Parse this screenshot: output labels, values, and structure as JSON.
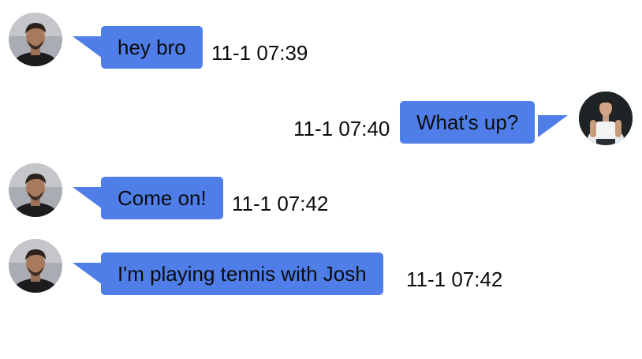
{
  "messages": [
    {
      "side": "incoming",
      "avatar_icon": "man-avatar-icon",
      "text": "hey bro",
      "time": "11-1 07:39"
    },
    {
      "side": "outgoing",
      "avatar_icon": "man-avatar-icon",
      "text": "What's up?",
      "time": "11-1 07:40"
    },
    {
      "side": "incoming",
      "avatar_icon": "man-avatar-icon",
      "text": "Come on!",
      "time": "11-1 07:42"
    },
    {
      "side": "incoming",
      "avatar_icon": "man-avatar-icon",
      "text": "I'm playing tennis with Josh",
      "time": "11-1 07:42"
    }
  ],
  "colors": {
    "bubble": "#4f7ee8",
    "text": "#0b0b0b",
    "background": "#ffffff"
  }
}
